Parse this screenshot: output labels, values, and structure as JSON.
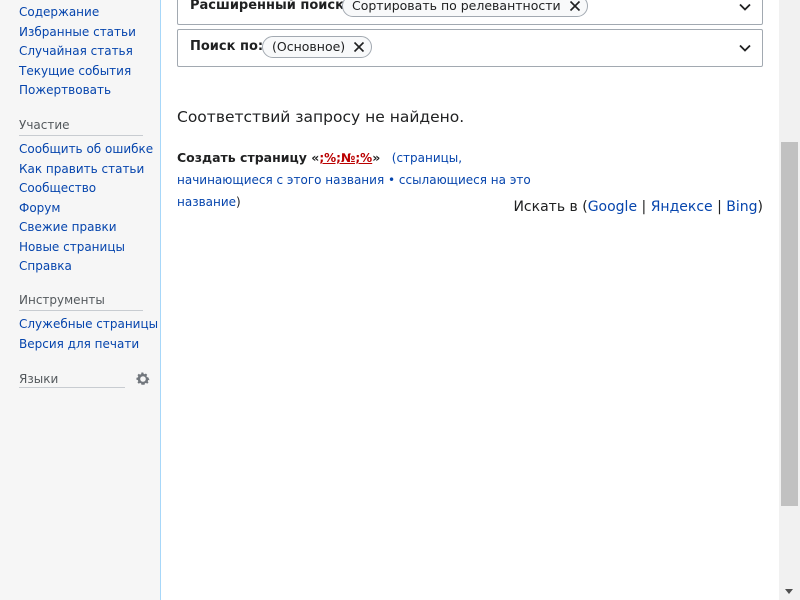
{
  "sidebar": {
    "navigation": [
      {
        "label": "Содержание"
      },
      {
        "label": "Избранные статьи"
      },
      {
        "label": "Случайная статья"
      },
      {
        "label": "Текущие события"
      },
      {
        "label": "Пожертвовать"
      }
    ],
    "participation": {
      "title": "Участие",
      "items": [
        {
          "label": "Сообщить об ошибке"
        },
        {
          "label": "Как править статьи"
        },
        {
          "label": "Сообщество"
        },
        {
          "label": "Форум"
        },
        {
          "label": "Свежие правки"
        },
        {
          "label": "Новые страницы"
        },
        {
          "label": "Справка"
        }
      ]
    },
    "tools": {
      "title": "Инструменты",
      "items": [
        {
          "label": "Служебные страницы"
        },
        {
          "label": "Версия для печати"
        }
      ]
    },
    "languages": {
      "title": "Языки",
      "settings_icon": "gear-icon"
    }
  },
  "search": {
    "advanced": {
      "label": "Расширенный поиск:",
      "chip": "Сортировать по релевантности"
    },
    "namespace": {
      "label": "Поиск по:",
      "chip": "(Основное)"
    }
  },
  "results": {
    "no_results": "Соответствий запросу не найдено.",
    "create_prefix": "Создать страницу «",
    "create_title": ";%;№;%",
    "create_suffix": "»",
    "open_paren": "(",
    "starting_with": "страницы, начинающиеся с этого названия",
    "bullet": " • ",
    "linking_to": "ссылающиеся на это название",
    "close_paren": ")"
  },
  "external_search": {
    "prefix": "Искать в (",
    "google": "Google",
    "sep1": " | ",
    "yandex": "Яндексе",
    "sep2": " | ",
    "bing": "Bing",
    "suffix": ")"
  },
  "colors": {
    "link": "#0645ad",
    "redlink": "#ba0000",
    "sidebar_bg": "#f6f6f6"
  }
}
